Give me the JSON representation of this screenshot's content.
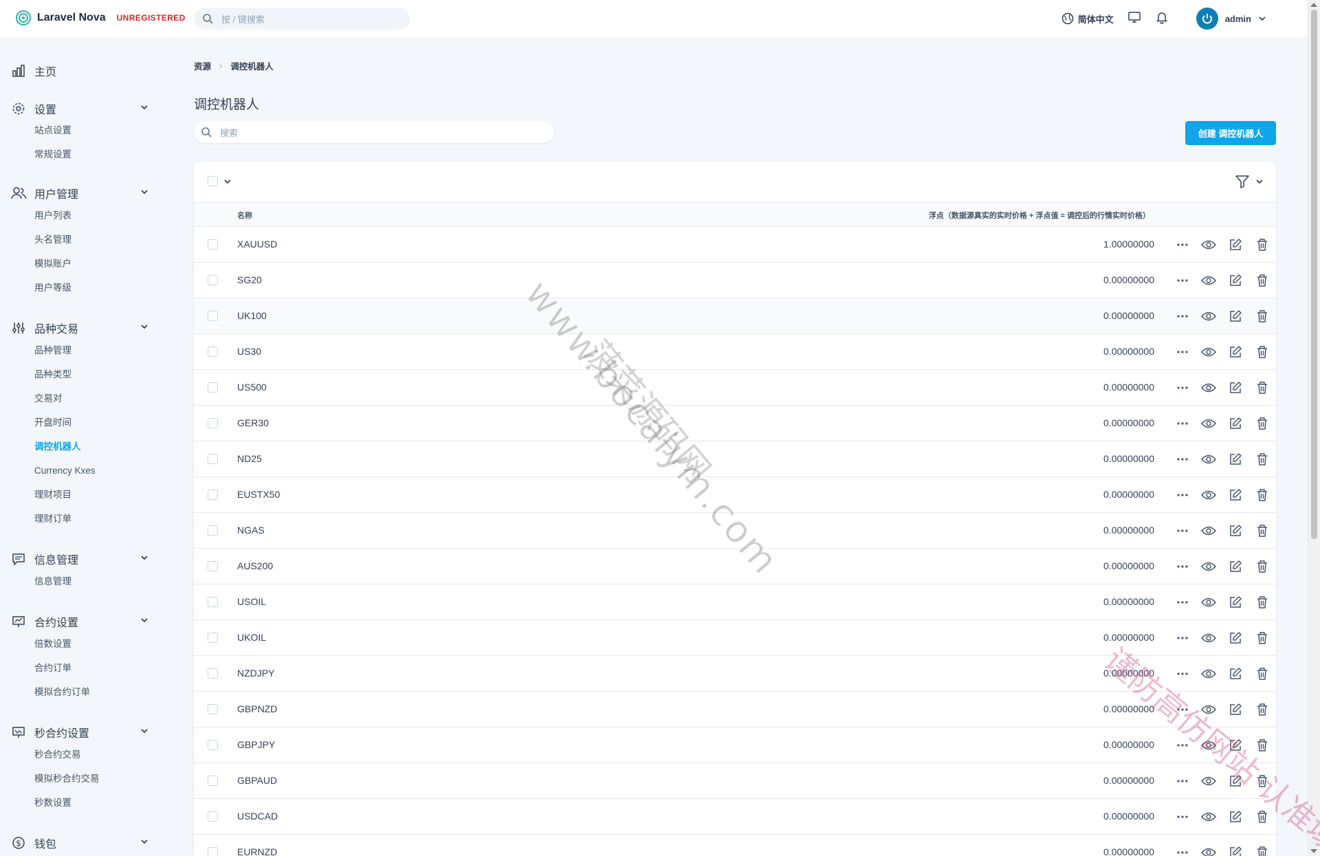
{
  "app": {
    "name": "Laravel Nova",
    "badge": "UNREGISTERED"
  },
  "header": {
    "search_placeholder": "按 / 键搜索",
    "language": "简体中文",
    "user": "admin"
  },
  "sidebar": {
    "groups": [
      {
        "label": "主页",
        "icon": "chart-icon",
        "items": []
      },
      {
        "label": "设置",
        "icon": "gear-icon",
        "items": [
          "站点设置",
          "常规设置"
        ]
      },
      {
        "label": "用户管理",
        "icon": "users-icon",
        "items": [
          "用户列表",
          "头名管理",
          "模拟账户",
          "用户等级"
        ]
      },
      {
        "label": "品种交易",
        "icon": "sliders-icon",
        "items": [
          "品种管理",
          "品种类型",
          "交易对",
          "开盘时间",
          "调控机器人",
          "Currency Kxes",
          "理财项目",
          "理财订单"
        ]
      },
      {
        "label": "信息管理",
        "icon": "message-icon",
        "items": [
          "信息管理"
        ]
      },
      {
        "label": "合约设置",
        "icon": "presentation-icon",
        "items": [
          "倍数设置",
          "合约订单",
          "模拟合约订单"
        ]
      },
      {
        "label": "秒合约设置",
        "icon": "presentation-chart-icon",
        "items": [
          "秒合约交易",
          "模拟秒合约交易",
          "秒数设置"
        ]
      },
      {
        "label": "钱包",
        "icon": "dollar-icon",
        "items": []
      }
    ],
    "active_item": "调控机器人"
  },
  "breadcrumb": {
    "root": "资源",
    "current": "调控机器人"
  },
  "page": {
    "title": "调控机器人",
    "search_placeholder": "搜索",
    "create_label": "创建 调控机器人"
  },
  "table": {
    "columns": {
      "name": "名称",
      "float": "浮点（数据源真实的实时价格 + 浮点值 = 调控后的行情实时价格）"
    },
    "rows": [
      {
        "name": "XAUUSD",
        "value": "1.00000000"
      },
      {
        "name": "SG20",
        "value": "0.00000000"
      },
      {
        "name": "UK100",
        "value": "0.00000000"
      },
      {
        "name": "US30",
        "value": "0.00000000"
      },
      {
        "name": "US500",
        "value": "0.00000000"
      },
      {
        "name": "GER30",
        "value": "0.00000000"
      },
      {
        "name": "ND25",
        "value": "0.00000000"
      },
      {
        "name": "EUSTX50",
        "value": "0.00000000"
      },
      {
        "name": "NGAS",
        "value": "0.00000000"
      },
      {
        "name": "AUS200",
        "value": "0.00000000"
      },
      {
        "name": "USOIL",
        "value": "0.00000000"
      },
      {
        "name": "UKOIL",
        "value": "0.00000000"
      },
      {
        "name": "NZDJPY",
        "value": "0.00000000"
      },
      {
        "name": "GBPNZD",
        "value": "0.00000000"
      },
      {
        "name": "GBPJPY",
        "value": "0.00000000"
      },
      {
        "name": "GBPAUD",
        "value": "0.00000000"
      },
      {
        "name": "USDCAD",
        "value": "0.00000000"
      },
      {
        "name": "EURNZD",
        "value": "0.00000000"
      }
    ]
  },
  "watermarks": {
    "domain": "www.bocaiym.com",
    "site": "菠菜源码网",
    "notice": "谨防高仿网站 认准域名"
  },
  "colors": {
    "accent": "#0ea5e9",
    "badge": "#dc2626",
    "background": "#f3f6fa"
  }
}
